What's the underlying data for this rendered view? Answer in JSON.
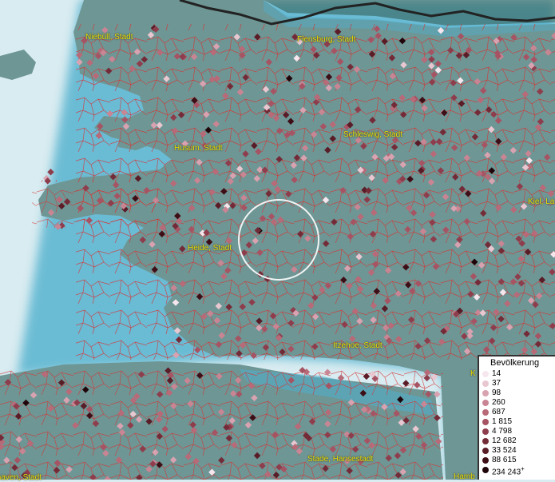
{
  "map": {
    "places": [
      {
        "id": "niebull",
        "label": "Niebüll, Stadt"
      },
      {
        "id": "flensburg",
        "label": "Flensburg, Stadt"
      },
      {
        "id": "schleswig",
        "label": "Schleswig, Stadt"
      },
      {
        "id": "husum",
        "label": "Husum, Stadt"
      },
      {
        "id": "kiel",
        "label": "Kiel, La"
      },
      {
        "id": "heide",
        "label": "Heide, Stadt"
      },
      {
        "id": "itzehoe",
        "label": "Itzehoe, Stadt"
      },
      {
        "id": "stade",
        "label": "Stade, Hansestadt"
      },
      {
        "id": "cuxhaven",
        "label": "Cuxhaven, Stadt"
      },
      {
        "id": "hamb",
        "label": "Hamb"
      },
      {
        "id": "k",
        "label": "K"
      }
    ],
    "colors": {
      "water": "#d9ecf1",
      "land": "#6e9694",
      "borders": "#d83030",
      "selection": "#ffffff"
    }
  },
  "legend": {
    "title": "Bevölkerung",
    "items": [
      {
        "label": "14",
        "color": "#f6e6ee"
      },
      {
        "label": "37",
        "color": "#e9c7d1"
      },
      {
        "label": "98",
        "color": "#d9a2b0"
      },
      {
        "label": "260",
        "color": "#c98593"
      },
      {
        "label": "687",
        "color": "#b86a78"
      },
      {
        "label": "1 815",
        "color": "#a65463"
      },
      {
        "label": "4 798",
        "color": "#8e3d4c"
      },
      {
        "label": "12 682",
        "color": "#742b38"
      },
      {
        "label": "33 524",
        "color": "#5a1c27"
      },
      {
        "label": "88 615",
        "color": "#3e0e17"
      },
      {
        "label": "234 243",
        "color": "#1f0509",
        "plus": "+"
      }
    ]
  }
}
